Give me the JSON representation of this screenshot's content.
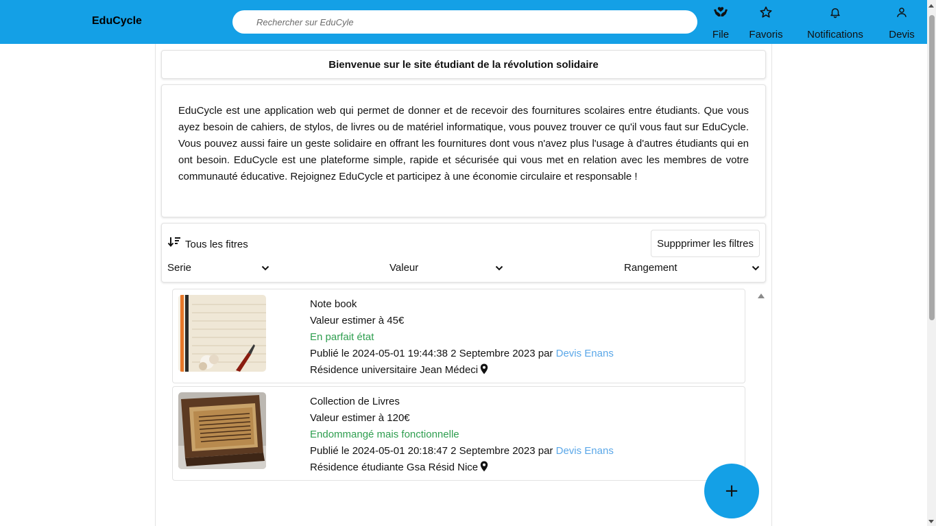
{
  "header": {
    "brand": "EduCycle",
    "search_placeholder": "Rechercher sur EduCyle",
    "nav": [
      {
        "label": "File",
        "icon": "hands-heart-icon"
      },
      {
        "label": "Favoris",
        "icon": "star-icon"
      },
      {
        "label": "Notifications",
        "icon": "bell-icon"
      },
      {
        "label": "Devis",
        "icon": "user-icon"
      }
    ]
  },
  "welcome": "Bienvenue sur le site étudiant de la révolution solidaire",
  "about": "EduCycle est une application web qui permet de donner et de recevoir des fournitures scolaires entre étudiants. Que vous ayez besoin de cahiers, de stylos, de livres ou de matériel informatique, vous pouvez trouver ce qu'il vous faut sur EduCycle. Vous pouvez aussi faire un geste solidaire en offrant les fournitures dont vous n'avez plus l'usage à d'autres étudiants qui en ont besoin. EduCycle est une plateforme simple, rapide et sécurisée qui vous met en relation avec les membres de votre communauté éducative. Rejoignez EduCycle et participez à une économie circulaire et responsable !",
  "filters": {
    "title": "Tous les fitres",
    "clear_label": "Suppprimer les filtres",
    "selects": [
      "Serie",
      "Valeur",
      "Rangement"
    ]
  },
  "items": [
    {
      "title": "Note book",
      "value": "Valeur estimer à 45€",
      "condition": "En parfait état",
      "published_prefix": "Publié le 2024-05-01 19:44:38 2 Septembre 2023 par",
      "author": "Devis Enans",
      "location": "Résidence universitaire Jean Médeci"
    },
    {
      "title": "Collection de Livres",
      "value": "Valeur estimer à 120€",
      "condition": "Endommangé mais fonctionnelle",
      "published_prefix": "Publié le 2024-05-01 20:18:47 2 Septembre 2023 par",
      "author": "Devis Enans",
      "location": "Résidence étudiante Gsa Résid Nice"
    }
  ],
  "fab_label": "+",
  "colors": {
    "primary": "#14a0e6",
    "condition": "#2e9e4f",
    "author_link": "#5aa7e8"
  }
}
